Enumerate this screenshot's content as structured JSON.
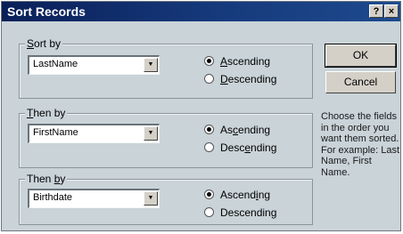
{
  "dialog": {
    "title": "Sort Records",
    "help_button": "?",
    "close_button": "×"
  },
  "groups": [
    {
      "label_pre": "",
      "label_key": "S",
      "label_post": "ort by",
      "field": "LastName",
      "ascending": {
        "pre": "",
        "key": "A",
        "post": "scending"
      },
      "descending": {
        "pre": "",
        "key": "D",
        "post": "escending"
      },
      "selected": "ascending"
    },
    {
      "label_pre": "",
      "label_key": "T",
      "label_post": "hen by",
      "field": "FirstName",
      "ascending": {
        "pre": "As",
        "key": "c",
        "post": "ending"
      },
      "descending": {
        "pre": "Desc",
        "key": "e",
        "post": "nding"
      },
      "selected": "ascending"
    },
    {
      "label_pre": "Then ",
      "label_key": "b",
      "label_post": "y",
      "field": "Birthdate",
      "ascending": {
        "pre": "Ascend",
        "key": "i",
        "post": "ng"
      },
      "descending": {
        "pre": "Descendin",
        "key": "g",
        "post": ""
      },
      "selected": "ascending"
    }
  ],
  "buttons": {
    "ok": "OK",
    "cancel": "Cancel"
  },
  "help_text": "Choose the fields in the order you want them sorted. For example: Last Name, First Name."
}
